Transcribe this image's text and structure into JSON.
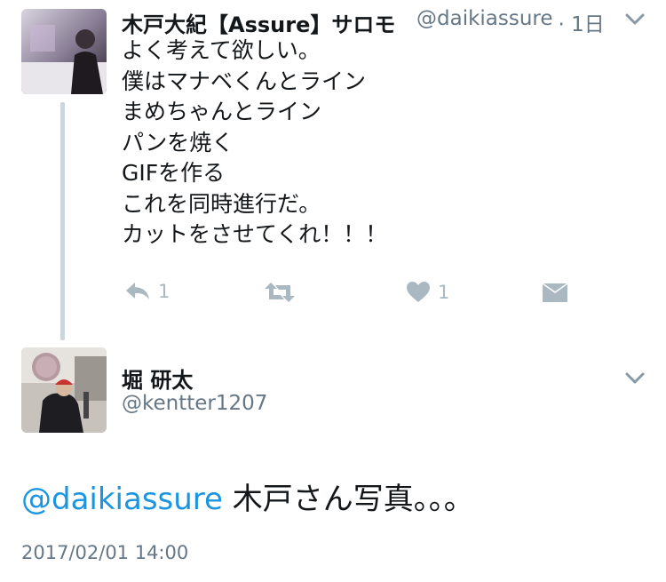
{
  "tweet1": {
    "display_name": "木戸大紀【Assure】サロモ",
    "handle": "@daikiassure",
    "time": "· 1日",
    "lines": [
      "よく考えて欲しい。",
      "僕はマナベくんとライン",
      "まめちゃんとライン",
      "パンを焼く",
      "GIFを作る",
      "これを同時進行だ。",
      "カットをさせてくれ！！！"
    ],
    "reply_count": "1",
    "like_count": "1"
  },
  "tweet2": {
    "display_name": "堀 研太",
    "handle": "@kentter1207",
    "mention": "@daikiassure",
    "text": " 木戸さん写真。。。",
    "timestamp": "2017/02/01 14:00"
  },
  "icons": [
    "reply-icon",
    "retweet-icon",
    "heart-icon",
    "dm-icon",
    "chevron-down-icon"
  ],
  "colors": {
    "link": "#1b95e0",
    "icon_gray": "#aab8c2",
    "secondary_text": "#657786",
    "thread_line": "#ccd6dd"
  }
}
